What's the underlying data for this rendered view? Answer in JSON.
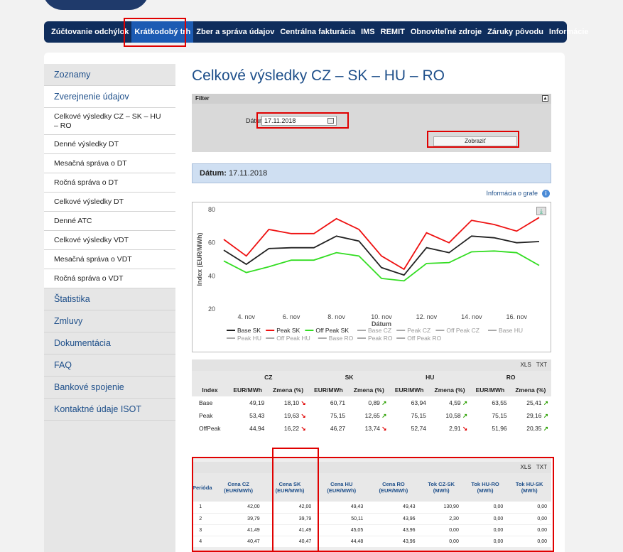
{
  "nav": {
    "items": [
      "Zúčtovanie odchýlok",
      "Krátkodobý trh",
      "Zber a správa údajov",
      "Centrálna fakturácia",
      "IMS",
      "REMIT",
      "Obnoviteľné zdroje",
      "Záruky pôvodu",
      "Informácie"
    ],
    "active_index": 1
  },
  "sidebar": {
    "items": [
      {
        "label": "Zoznamy"
      },
      {
        "label": "Zverejnenie údajov"
      },
      {
        "label": "Celkové výsledky CZ – SK – HU – RO"
      },
      {
        "label": "Denné výsledky DT"
      },
      {
        "label": "Mesačná správa o DT"
      },
      {
        "label": "Ročná správa o DT"
      },
      {
        "label": "Celkové výsledky DT"
      },
      {
        "label": "Denné ATC"
      },
      {
        "label": "Celkové výsledky VDT"
      },
      {
        "label": "Mesačná správa o VDT"
      },
      {
        "label": "Ročná správa o VDT"
      },
      {
        "label": "Štatistika"
      },
      {
        "label": "Zmluvy"
      },
      {
        "label": "Dokumentácia"
      },
      {
        "label": "FAQ"
      },
      {
        "label": "Bankové spojenie"
      },
      {
        "label": "Kontaktné údaje ISOT"
      }
    ]
  },
  "page": {
    "title": "Celkové výsledky CZ – SK – HU – RO"
  },
  "filter": {
    "header": "Filter",
    "toggle": "▴",
    "date_label": "Dátum",
    "date_value": "17.11.2018",
    "show_button": "Zobraziť"
  },
  "date_bar": {
    "label": "Dátum:",
    "value": "17.11.2018"
  },
  "graph_info": {
    "text": "Informácia o grafe",
    "icon": "info-icon"
  },
  "chart_data": {
    "type": "line",
    "ylabel": "Index (EUR/MWh)",
    "xlabel": "Dátum",
    "ylim": [
      20,
      80
    ],
    "yticks": [
      20,
      40,
      60,
      80
    ],
    "x": [
      "3. nov",
      "4. nov",
      "5. nov",
      "6. nov",
      "7. nov",
      "8. nov",
      "9. nov",
      "10. nov",
      "11. nov",
      "12. nov",
      "13. nov",
      "14. nov",
      "15. nov",
      "16. nov",
      "17. nov"
    ],
    "xtick_labels": [
      "4. nov",
      "6. nov",
      "8. nov",
      "10. nov",
      "12. nov",
      "14. nov",
      "16. nov"
    ],
    "series": [
      {
        "name": "Base SK",
        "color": "#222222",
        "values": [
          55.5,
          47,
          56.5,
          57,
          57,
          64,
          61,
          45,
          40.5,
          57,
          54,
          64,
          63,
          60,
          60.7
        ]
      },
      {
        "name": "Peak SK",
        "color": "#ee1111",
        "values": [
          62,
          52,
          68,
          65.5,
          65.5,
          74.5,
          68,
          52,
          44,
          66,
          60,
          73.5,
          71,
          67,
          75.2
        ]
      },
      {
        "name": "Off Peak SK",
        "color": "#33dd22",
        "values": [
          49,
          42,
          45.5,
          49.5,
          49.5,
          54,
          52,
          38.5,
          37,
          47.5,
          48,
          54.5,
          55,
          54,
          46.3
        ]
      }
    ],
    "legend_row1": [
      "Base SK",
      "Peak SK",
      "Off Peak SK",
      "Base CZ",
      "Peak CZ",
      "Off Peak CZ",
      "Base HU"
    ],
    "legend_row2": [
      "Peak HU",
      "Off Peak HU",
      "Base RO",
      "Peak RO",
      "Off Peak RO"
    ],
    "legend_hidden_color": "#aaaaaa"
  },
  "summary_table": {
    "toolbar": [
      "XLS",
      "TXT"
    ],
    "groups": [
      "CZ",
      "SK",
      "HU",
      "RO"
    ],
    "columns": [
      "Index",
      "EUR/MWh",
      "Zmena (%)",
      "EUR/MWh",
      "Zmena (%)",
      "EUR/MWh",
      "Zmena (%)",
      "EUR/MWh",
      "Zmena (%)"
    ],
    "rows": [
      {
        "index": "Base",
        "cells": [
          [
            "49,19",
            "18,10",
            "down"
          ],
          [
            "60,71",
            "0,89",
            "up"
          ],
          [
            "63,94",
            "4,59",
            "up"
          ],
          [
            "63,55",
            "25,41",
            "up"
          ]
        ]
      },
      {
        "index": "Peak",
        "cells": [
          [
            "53,43",
            "19,63",
            "down"
          ],
          [
            "75,15",
            "12,65",
            "up"
          ],
          [
            "75,15",
            "10,58",
            "up"
          ],
          [
            "75,15",
            "29,16",
            "up"
          ]
        ]
      },
      {
        "index": "OffPeak",
        "cells": [
          [
            "44,94",
            "16,22",
            "down"
          ],
          [
            "46,27",
            "13,74",
            "down"
          ],
          [
            "52,74",
            "2,91",
            "down"
          ],
          [
            "51,96",
            "20,35",
            "up"
          ]
        ]
      }
    ]
  },
  "period_table": {
    "toolbar": [
      "XLS",
      "TXT"
    ],
    "columns": [
      "Perióda",
      "Cena CZ (EUR/MWh)",
      "Cena SK (EUR/MWh)",
      "Cena HU (EUR/MWh)",
      "Cena RO (EUR/MWh)",
      "Tok CZ-SK (MWh)",
      "Tok HU-RO (MWh)",
      "Tok HU-SK (MWh)"
    ],
    "rows": [
      [
        "1",
        "42,00",
        "42,00",
        "49,43",
        "49,43",
        "130,90",
        "0,00",
        "0,00"
      ],
      [
        "2",
        "39,79",
        "39,79",
        "50,11",
        "43,96",
        "2,30",
        "0,00",
        "0,00"
      ],
      [
        "3",
        "41,49",
        "41,49",
        "45,05",
        "43,96",
        "0,00",
        "0,00",
        "0,00"
      ],
      [
        "4",
        "40,47",
        "40,47",
        "44,48",
        "43,96",
        "0,00",
        "0,00",
        "0,00"
      ]
    ]
  }
}
